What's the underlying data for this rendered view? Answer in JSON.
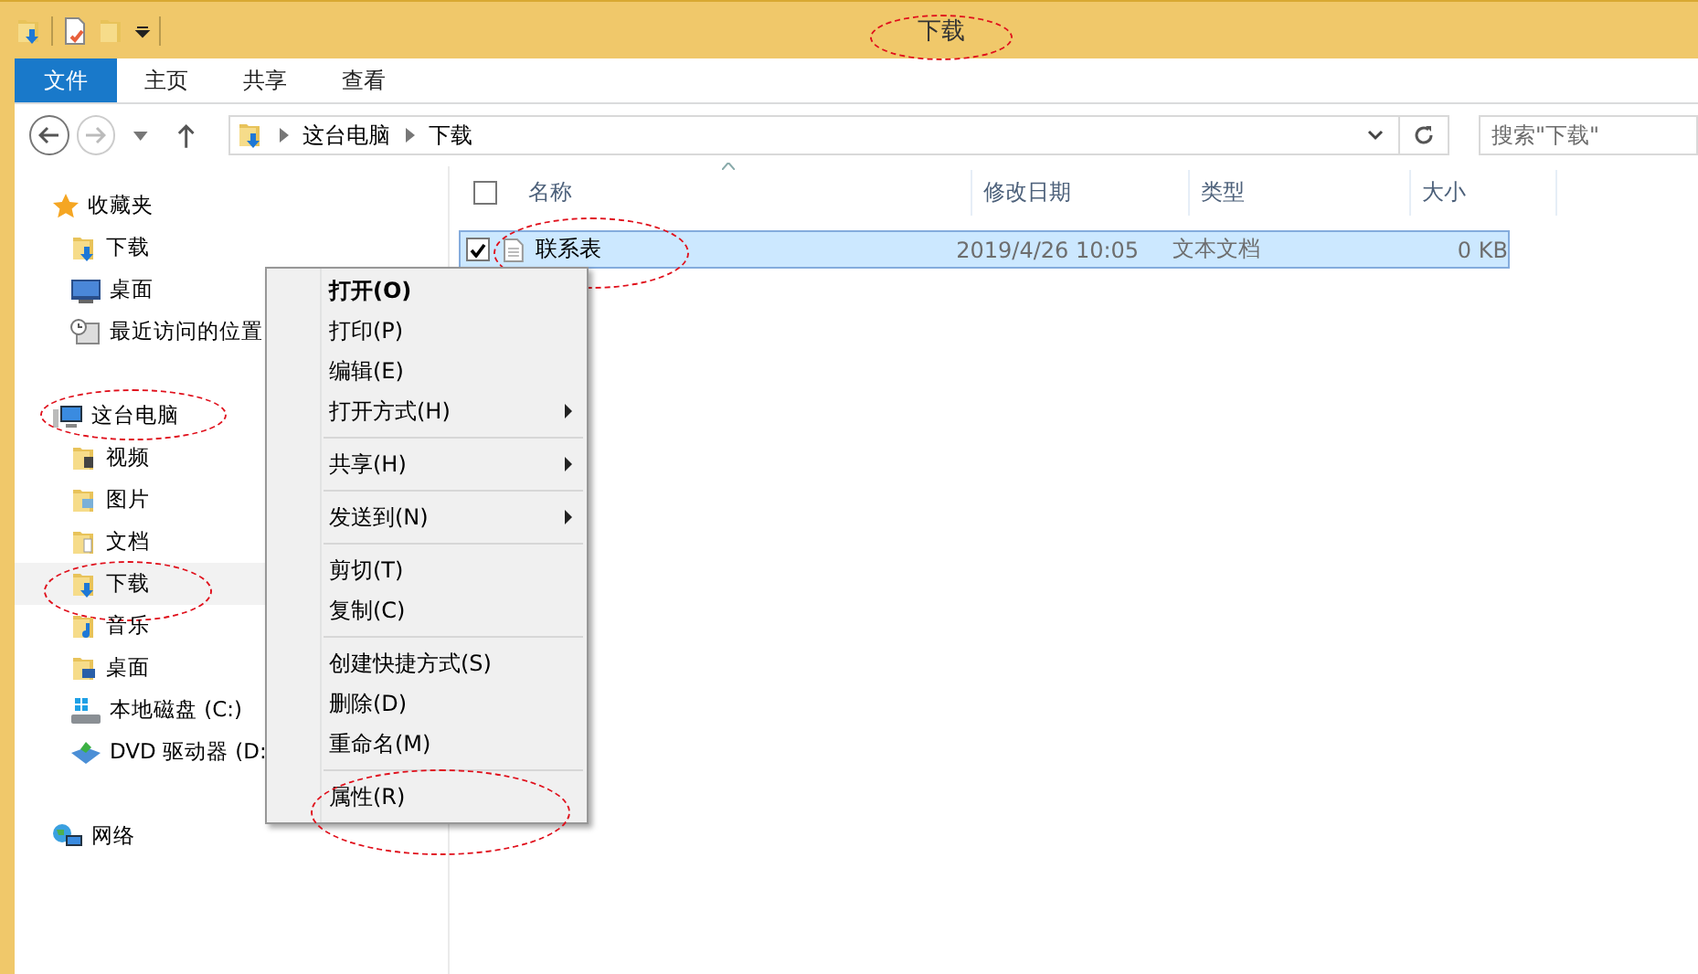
{
  "window": {
    "title": "下载",
    "title_circled": true
  },
  "ribbon_tabs": [
    {
      "label": "文件",
      "selected": true
    },
    {
      "label": "主页",
      "selected": false
    },
    {
      "label": "共享",
      "selected": false
    },
    {
      "label": "查看",
      "selected": false
    }
  ],
  "address": {
    "path": [
      "这台电脑",
      "下载"
    ]
  },
  "search": {
    "placeholder": "搜索\"下载\""
  },
  "nav": [
    {
      "label": "收藏夹",
      "kind": "star",
      "circled": false,
      "highlighted": false,
      "children": [
        {
          "label": "下载",
          "kind": "folder-download",
          "circled": false,
          "highlighted": false
        },
        {
          "label": "桌面",
          "kind": "desktop",
          "circled": false,
          "highlighted": false
        },
        {
          "label": "最近访问的位置",
          "kind": "recent",
          "circled": false,
          "highlighted": false
        }
      ]
    },
    {
      "label": "这台电脑",
      "kind": "computer",
      "circled": true,
      "highlighted": false,
      "children": [
        {
          "label": "视频",
          "kind": "folder-video",
          "circled": false,
          "highlighted": false
        },
        {
          "label": "图片",
          "kind": "folder-picture",
          "circled": false,
          "highlighted": false
        },
        {
          "label": "文档",
          "kind": "folder-document",
          "circled": false,
          "highlighted": false
        },
        {
          "label": "下载",
          "kind": "folder-download",
          "circled": true,
          "highlighted": true
        },
        {
          "label": "音乐",
          "kind": "folder-music",
          "circled": false,
          "highlighted": false
        },
        {
          "label": "桌面",
          "kind": "folder-desktop",
          "circled": false,
          "highlighted": false
        },
        {
          "label": "本地磁盘 (C:)",
          "kind": "drive",
          "circled": false,
          "highlighted": false
        },
        {
          "label": "DVD 驱动器 (D:",
          "kind": "dvd",
          "circled": false,
          "highlighted": false
        }
      ]
    },
    {
      "label": "网络",
      "kind": "network",
      "circled": false,
      "highlighted": false
    }
  ],
  "select_all_checked": false,
  "columns": [
    {
      "label": "名称",
      "sorted": true
    },
    {
      "label": "修改日期",
      "sorted": false
    },
    {
      "label": "类型",
      "sorted": false
    },
    {
      "label": "大小",
      "sorted": false
    }
  ],
  "files": [
    {
      "name": "联系表",
      "modified": "2019/4/26 10:05",
      "type": "文本文档",
      "size": "0 KB",
      "selected": true,
      "checked": true,
      "circled": true
    }
  ],
  "context_menu": {
    "groups": [
      [
        {
          "label": "打开(O)",
          "default": true,
          "submenu": false,
          "circled": false
        },
        {
          "label": "打印(P)",
          "default": false,
          "submenu": false,
          "circled": false
        },
        {
          "label": "编辑(E)",
          "default": false,
          "submenu": false,
          "circled": false
        },
        {
          "label": "打开方式(H)",
          "default": false,
          "submenu": true,
          "circled": false
        }
      ],
      [
        {
          "label": "共享(H)",
          "default": false,
          "submenu": true,
          "circled": false
        }
      ],
      [
        {
          "label": "发送到(N)",
          "default": false,
          "submenu": true,
          "circled": false
        }
      ],
      [
        {
          "label": "剪切(T)",
          "default": false,
          "submenu": false,
          "circled": false
        },
        {
          "label": "复制(C)",
          "default": false,
          "submenu": false,
          "circled": false
        }
      ],
      [
        {
          "label": "创建快捷方式(S)",
          "default": false,
          "submenu": false,
          "circled": false
        },
        {
          "label": "删除(D)",
          "default": false,
          "submenu": false,
          "circled": false
        },
        {
          "label": "重命名(M)",
          "default": false,
          "submenu": false,
          "circled": false
        }
      ],
      [
        {
          "label": "属性(R)",
          "default": false,
          "submenu": false,
          "circled": true
        }
      ]
    ]
  }
}
